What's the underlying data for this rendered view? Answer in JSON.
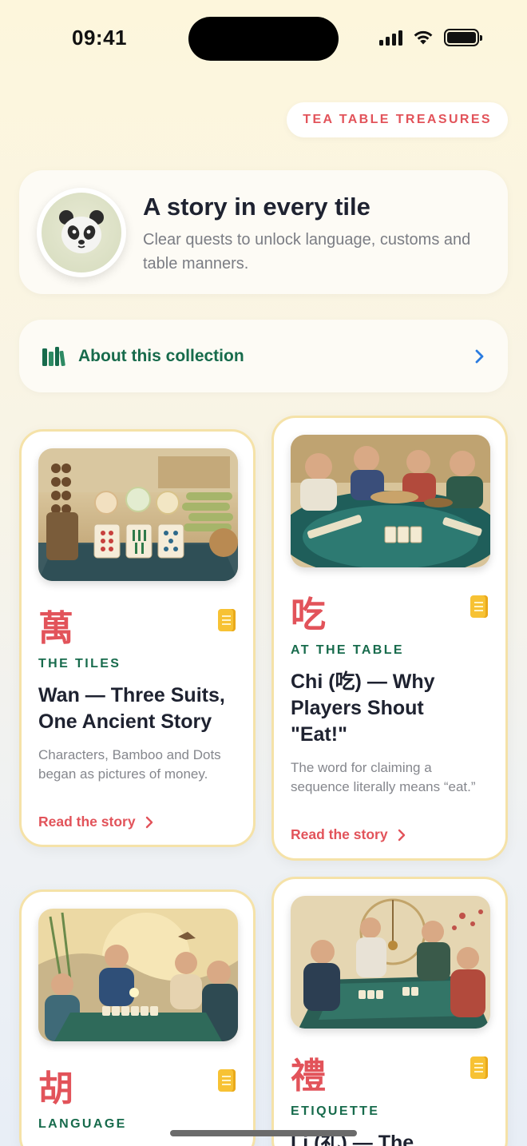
{
  "status": {
    "time": "09:41"
  },
  "header": {
    "pill_label": "TEA TABLE TREASURES"
  },
  "hero": {
    "title": "A story in every tile",
    "subtitle": "Clear quests to unlock language, customs and table manners.",
    "avatar_icon": "panda-icon"
  },
  "about": {
    "label": "About this collection",
    "icon": "books-icon"
  },
  "cards": [
    {
      "glyph": "萬",
      "category": "THE TILES",
      "title": "Wan — Three Suits, One Ancient Story",
      "description": "Characters, Bamboo and Dots began as pictures of money.",
      "link": "Read the story"
    },
    {
      "glyph": "吃",
      "category": "AT THE TABLE",
      "title": "Chi (吃) — Why Players Shout \"Eat!\"",
      "description": "The word for claiming a sequence literally means “eat.”",
      "link": "Read the story"
    },
    {
      "glyph": "胡",
      "category": "LANGUAGE"
    },
    {
      "glyph": "禮",
      "category": "ETIQUETTE",
      "title": "Li (礼) — The"
    }
  ],
  "colors": {
    "accent_red": "#e2535a",
    "accent_green": "#176b4c",
    "card_border": "#f5e2a8",
    "note_yellow": "#f7c234"
  }
}
